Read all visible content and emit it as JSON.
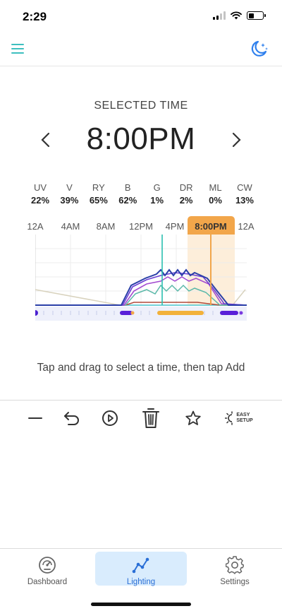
{
  "status": {
    "time": "2:29"
  },
  "selected": {
    "label": "SELECTED TIME",
    "time": "8:00PM"
  },
  "channels": [
    {
      "name": "UV",
      "value": "22%"
    },
    {
      "name": "V",
      "value": "39%"
    },
    {
      "name": "RY",
      "value": "65%"
    },
    {
      "name": "B",
      "value": "62%"
    },
    {
      "name": "G",
      "value": "1%"
    },
    {
      "name": "DR",
      "value": "2%"
    },
    {
      "name": "ML",
      "value": "0%"
    },
    {
      "name": "CW",
      "value": "13%"
    }
  ],
  "axis": {
    "labels": [
      "12A",
      "4AM",
      "8AM",
      "12PM",
      "4PM",
      "12A"
    ],
    "selected_label": "8:00PM"
  },
  "hint": "Tap and drag to select a time, then tap Add",
  "toolbar": {
    "easy_setup_line1": "EASY",
    "easy_setup_line2": "SETUP"
  },
  "tabs": [
    {
      "label": "Dashboard",
      "icon": "gauge-icon",
      "active": false
    },
    {
      "label": "Lighting",
      "icon": "chart-line-icon",
      "active": true
    },
    {
      "label": "Settings",
      "icon": "gear-icon",
      "active": false
    }
  ],
  "colors": {
    "accent_teal": "#3dbfbf",
    "selected_orange": "#f2a64a",
    "active_tab_bg": "#d9ecfd",
    "active_tab_text": "#2a6fd6",
    "moon_blue": "#2f80ed"
  }
}
